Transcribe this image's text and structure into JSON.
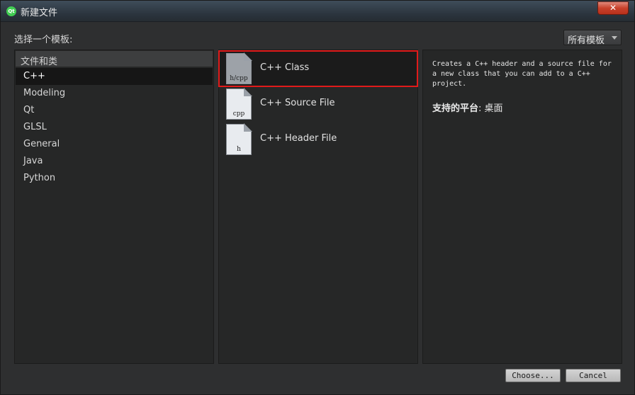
{
  "window": {
    "title": "新建文件",
    "app_icon_text": "Qt",
    "close_label": "✕"
  },
  "choose_label": "选择一个模板:",
  "filter": {
    "selected": "所有模板"
  },
  "categories": {
    "header": "文件和类",
    "items": [
      {
        "label": "C++",
        "selected": true
      },
      {
        "label": "Modeling"
      },
      {
        "label": "Qt"
      },
      {
        "label": "GLSL"
      },
      {
        "label": "General"
      },
      {
        "label": "Java"
      },
      {
        "label": "Python"
      }
    ]
  },
  "templates": [
    {
      "label": "C++ Class",
      "icon_text": "h/cpp",
      "icon": "document-icon",
      "selected": true
    },
    {
      "label": "C++ Source File",
      "icon_text": "cpp",
      "icon": "document-icon"
    },
    {
      "label": "C++ Header File",
      "icon_text": "h",
      "icon": "document-icon"
    }
  ],
  "description": {
    "text": "Creates a C++ header and a source file for a new class that you can add to a C++ project.",
    "platform_label": "支持的平台",
    "platform_value": ": 桌面"
  },
  "buttons": {
    "choose": "Choose...",
    "cancel": "Cancel"
  },
  "colors": {
    "selection_outline": "#e11a1a",
    "background": "#2e2f30",
    "panel": "#262727"
  }
}
